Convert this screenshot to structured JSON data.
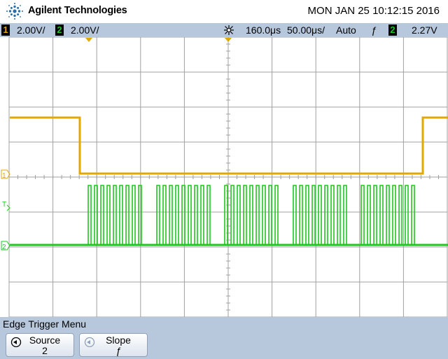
{
  "header": {
    "brand": "Agilent Technologies",
    "datetime": "MON JAN 25 10:12:15 2016"
  },
  "status": {
    "ch1_number": "1",
    "ch1_scale": "2.00V/",
    "ch2_number": "2",
    "ch2_scale": "2.00V/",
    "time_delay": "160.0&#x3bc;s",
    "time_scale": "50.00&#x3bc;s/",
    "trigger_mode": "Auto",
    "trigger_slope_symbol": "ƒ",
    "trigger_source": "2",
    "trigger_level": "2.27V"
  },
  "markers": {
    "ch1_ground": "1",
    "ch2_ground": "2",
    "trigger_level": "T"
  },
  "colors": {
    "ch1": "#e0a800",
    "ch2": "#1ec81e",
    "grid": "#a0a0a0",
    "menu_bg": "#b8c8dc"
  },
  "menu": {
    "title": "Edge Trigger Menu",
    "softkeys": [
      {
        "label": "Source",
        "value": "2",
        "icon": "rotary-knob-icon"
      },
      {
        "label": "Slope",
        "value": "ƒ",
        "icon": "rotary-knob-icon"
      }
    ]
  }
}
